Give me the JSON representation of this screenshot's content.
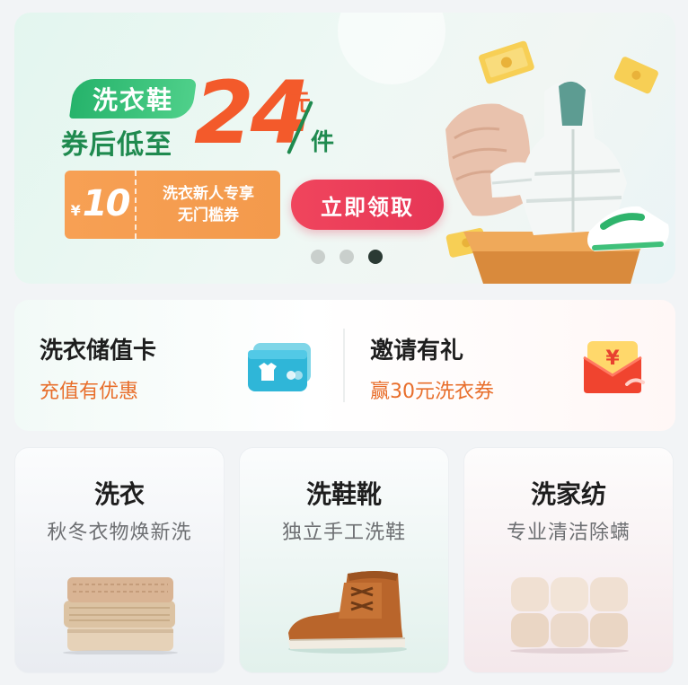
{
  "banner": {
    "tag": "洗衣鞋",
    "subtitle": "券后低至",
    "price": "24",
    "unit_top": "元",
    "unit_bottom": "件",
    "coupon": {
      "currency": "¥",
      "amount": "10",
      "line1": "洗衣新人专享",
      "line2": "无门槛券"
    },
    "claim_button": "立即领取",
    "carousel": {
      "count": 3,
      "active_index": 2
    }
  },
  "services": [
    {
      "title": "洗衣储值卡",
      "subtitle": "充值有优惠",
      "icon": "card-icon"
    },
    {
      "title": "邀请有礼",
      "subtitle": "赢30元洗衣券",
      "icon": "red-envelope-icon"
    }
  ],
  "categories": [
    {
      "title": "洗衣",
      "subtitle": "秋冬衣物焕新洗",
      "image": "folded-sweaters"
    },
    {
      "title": "洗鞋靴",
      "subtitle": "独立手工洗鞋",
      "image": "boot"
    },
    {
      "title": "洗家纺",
      "subtitle": "专业清洁除螨",
      "image": "towels"
    }
  ],
  "colors": {
    "accent_red": "#e63656",
    "price_orange": "#f35a2b",
    "brand_green": "#26b36b",
    "coupon_orange": "#f39a4c",
    "subtitle_orange": "#e86e2b"
  }
}
